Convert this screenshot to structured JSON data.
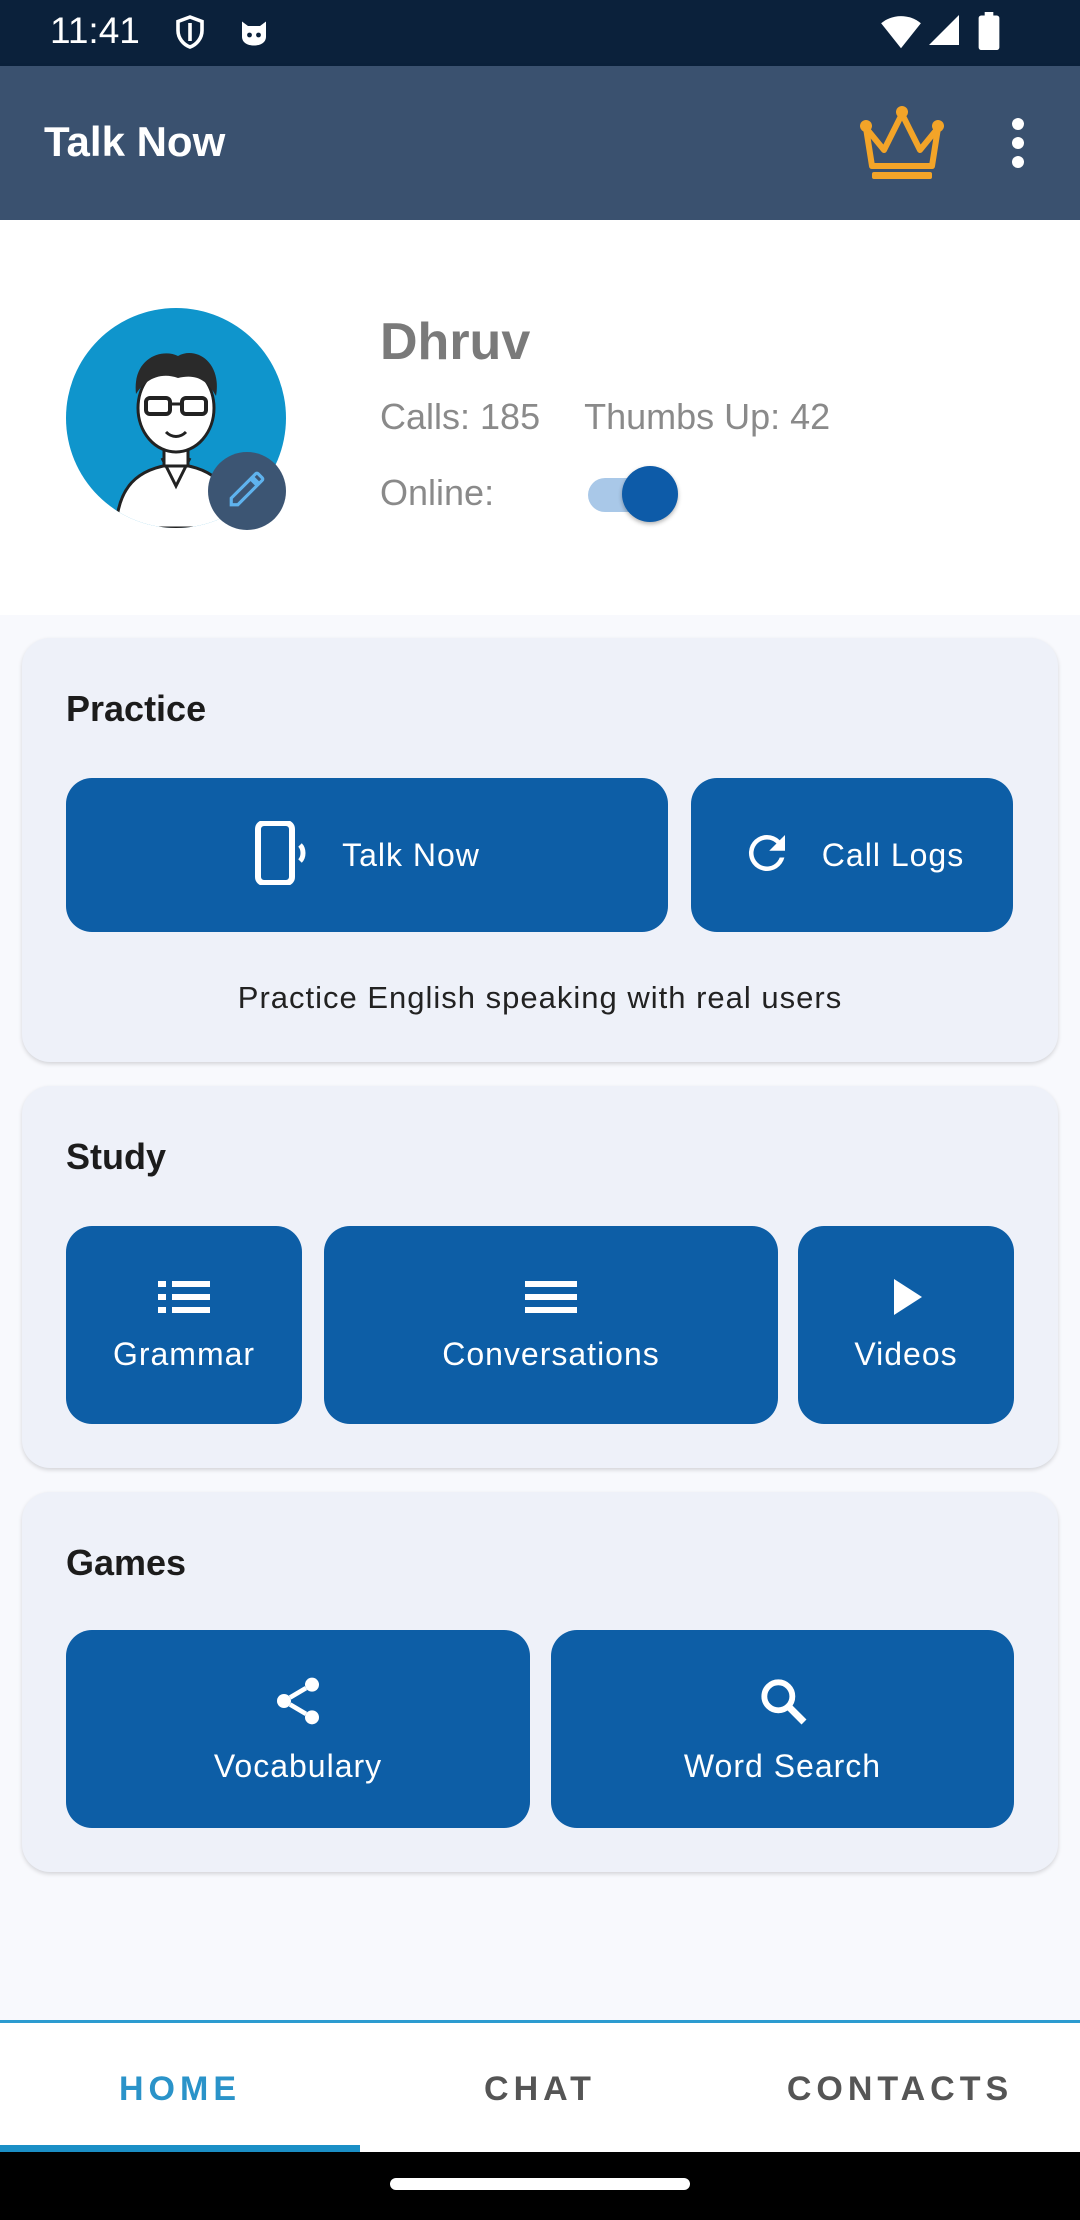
{
  "status_bar": {
    "time": "11:41"
  },
  "app_bar": {
    "title": "Talk Now"
  },
  "profile": {
    "name": "Dhruv",
    "calls_text": "Calls: 185",
    "thumbs_text": "Thumbs Up: 42",
    "online_label": "Online:",
    "online": true
  },
  "practice": {
    "title": "Practice",
    "talk_now_label": "Talk Now",
    "call_logs_label": "Call Logs",
    "caption": "Practice English speaking with real users"
  },
  "study": {
    "title": "Study",
    "grammar_label": "Grammar",
    "conversations_label": "Conversations",
    "videos_label": "Videos"
  },
  "games": {
    "title": "Games",
    "vocabulary_label": "Vocabulary",
    "word_search_label": "Word Search"
  },
  "bottom_nav": {
    "tabs": [
      {
        "label": "HOME",
        "active": true
      },
      {
        "label": "CHAT",
        "active": false
      },
      {
        "label": "CONTACTS",
        "active": false
      }
    ]
  },
  "colors": {
    "status_bar": "#0b213b",
    "app_bar": "#3a516f",
    "button": "#0d5ea6",
    "card": "#eef1f9",
    "accent": "#2a93c9",
    "crown": "#f3a428"
  },
  "icons": {
    "app_bar": [
      "crown-icon",
      "more-vert-icon"
    ],
    "practice": [
      "phone-ringing-icon",
      "refresh-icon"
    ],
    "study": [
      "list-icon",
      "menu-lines-icon",
      "play-icon"
    ],
    "games": [
      "share-icon",
      "search-icon"
    ]
  }
}
